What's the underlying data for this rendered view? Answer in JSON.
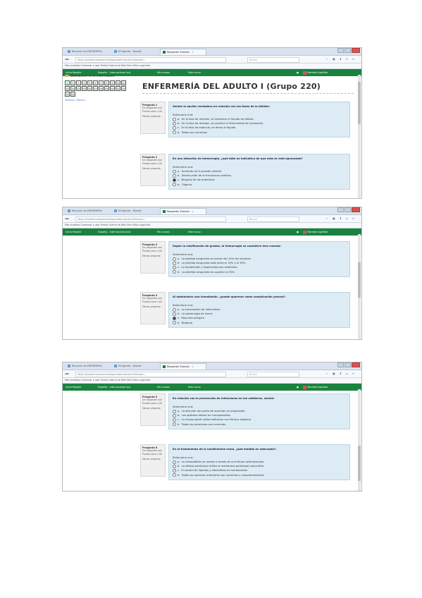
{
  "browser": {
    "tabs": [
      "Resumen de ENFERMERIA",
      "Mi Agenda - Moodle",
      "Responder Examen"
    ],
    "url": "https://moodle.example/mod/quiz/attempt.php?attempt=...",
    "search_placeholder": "Buscar",
    "bookmarks": "Más visitados   Comenzar a usar Firefox   Galería de Web Slice   Sitios sugeridos"
  },
  "site_nav": {
    "home": "Inicio Moodle",
    "language": "Español - Internacional (es)",
    "courses": "Mis cursos",
    "this_course": "Este curso",
    "user": "Nombre Apellido"
  },
  "quiz_nav": {
    "header": "NAVEGACIÓN POR EL CUESTIONARIO",
    "questions": [
      "1",
      "2",
      "3",
      "4",
      "5",
      "6",
      "7",
      "8",
      "9",
      "10",
      "11",
      "12",
      "13",
      "14",
      "15",
      "16",
      "17",
      "18",
      "19",
      "20",
      "21",
      "22",
      "23",
      "24"
    ],
    "finish_link": "Terminar intento..."
  },
  "page_title": "ENFERMERÍA DEL ADULTO I (Grupo 220)",
  "question_info": {
    "status": "Sin responder aún",
    "points": "Puntúa como 1,00",
    "flag": "Marcar pregunta"
  },
  "prompt": "Seleccione una:",
  "questions": [
    {
      "number": "Pregunta 1",
      "text": "Señale la opción verdadera en relación con las fases de la diálisis:",
      "options": [
        {
          "letter": "a.",
          "text": "En la fase de infusión, se introduce el líquido de diálisis",
          "selected": false
        },
        {
          "letter": "b.",
          "text": "En la fase de drenaje, se produce el intercambio de sustancias",
          "selected": false
        },
        {
          "letter": "c.",
          "text": "En la fase de estancia, se drena el líquido",
          "selected": false
        },
        {
          "letter": "d.",
          "text": "Todas son correctas",
          "selected": false
        }
      ]
    },
    {
      "number": "Pregunta 2",
      "text": "En una situación de hemorragia, ¿qué dato es indicativo de que esta se está agravando?",
      "options": [
        {
          "letter": "a.",
          "text": "Aumento de la presión arterial",
          "selected": false
        },
        {
          "letter": "b.",
          "text": "Disminución de la frecuencia cardíaca",
          "selected": false
        },
        {
          "letter": "c.",
          "text": "Ninguna de las anteriores",
          "selected": true
        },
        {
          "letter": "d.",
          "text": "Oliguria",
          "selected": false
        }
      ]
    },
    {
      "number": "Pregunta 3",
      "text": "Según la clasificación de grados, la hemorragia se considera leve cuando:",
      "options": [
        {
          "letter": "a.",
          "text": "La pérdida sanguínea es menor del 15% del volumen",
          "selected": false
        },
        {
          "letter": "b.",
          "text": "La pérdida sanguínea está entre el 15% y el 30%",
          "selected": false
        },
        {
          "letter": "c.",
          "text": "La hipotensión y taquicardia son evidentes",
          "selected": false
        },
        {
          "letter": "d.",
          "text": "La pérdida sanguínea es superior al 30%",
          "selected": false
        }
      ]
    },
    {
      "number": "Pregunta 4",
      "text": "Al administrar una transfusión, ¿puede aparecer como complicación precoz?:",
      "options": [
        {
          "letter": "a.",
          "text": "La transmisión de infecciones",
          "selected": false
        },
        {
          "letter": "b.",
          "text": "La sobrecarga de hierro",
          "selected": false
        },
        {
          "letter": "c.",
          "text": "Reacción alérgica",
          "selected": true
        },
        {
          "letter": "d.",
          "text": "Ninguna",
          "selected": false
        }
      ]
    },
    {
      "number": "Pregunta 5",
      "text": "En relación con la prevención de infecciones en los catéteres, señale:",
      "options": [
        {
          "letter": "a.",
          "text": "La elección del punto de inserción es importante",
          "selected": false
        },
        {
          "letter": "b.",
          "text": "Los apósitos deben ser transparentes",
          "selected": false
        },
        {
          "letter": "c.",
          "text": "La manipulación debe realizarse con técnica aséptica",
          "selected": false
        },
        {
          "letter": "d.",
          "text": "Todas las anteriores son correctas",
          "selected": false
        }
      ]
    },
    {
      "number": "Pregunta 6",
      "text": "En el tratamiento de la insuficiencia renal, ¿qué medida es adecuada?:",
      "options": [
        {
          "letter": "a.",
          "text": "La hemodiálisis se realiza a través de una fístula arteriovenosa",
          "selected": false
        },
        {
          "letter": "b.",
          "text": "La diálisis peritoneal utiliza la membrana peritoneal como filtro",
          "selected": false
        },
        {
          "letter": "c.",
          "text": "El control de líquidos y electrolitos es fundamental",
          "selected": false
        },
        {
          "letter": "d.",
          "text": "Todas las opciones anteriores son correctas y complementarias",
          "selected": false
        }
      ]
    }
  ]
}
